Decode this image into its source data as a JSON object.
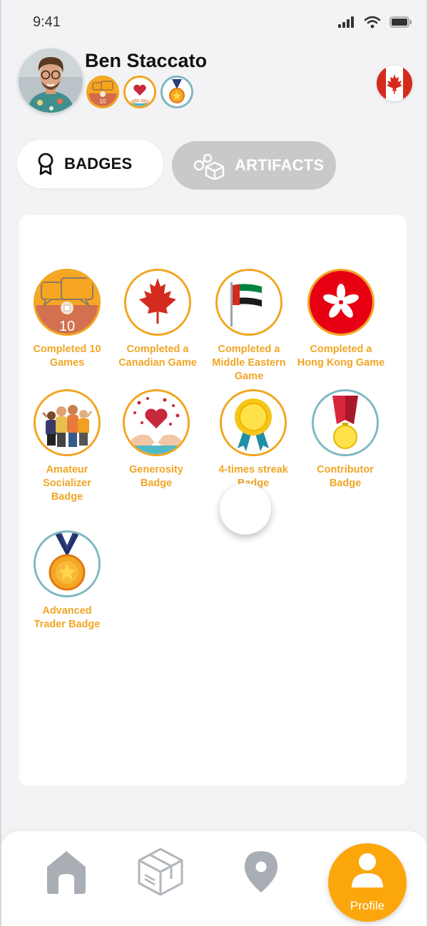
{
  "status_bar": {
    "time": "9:41"
  },
  "user": {
    "name": "Ben Staccato",
    "mini_badge_count": "10"
  },
  "tabs": {
    "badges": "BADGES",
    "artifacts": "ARTIFACTS"
  },
  "badges": [
    {
      "line1": "Completed 10",
      "line2": "Games",
      "line3": "",
      "icon": "10",
      "ring": "orange"
    },
    {
      "line1": "Completed a",
      "line2": "Canadian Game",
      "line3": "",
      "ring": "orange"
    },
    {
      "line1": "Completed a",
      "line2": "Middle Eastern",
      "line3": "Game",
      "ring": "orange"
    },
    {
      "line1": "Completed a",
      "line2": "Hong Kong Game",
      "line3": "",
      "ring": "orange"
    },
    {
      "line1": "Amateur",
      "line2": "Socializer",
      "line3": "Badge",
      "ring": "orange"
    },
    {
      "line1": "Generosity",
      "line2": "Badge",
      "line3": "",
      "ring": "orange"
    },
    {
      "line1": "4-times streak",
      "line2": "Badge",
      "line3": "",
      "ring": "orange"
    },
    {
      "line1": "Contributor",
      "line2": "Badge",
      "line3": "",
      "ring": "teal"
    },
    {
      "line1": "Advanced",
      "line2": "Trader Badge",
      "line3": "",
      "ring": "teal"
    }
  ],
  "nav": {
    "profile": "Profile"
  },
  "colors": {
    "accent": "#fba70c",
    "badge_text": "#f0a626",
    "tab_inactive": "#c9c9cc"
  },
  "icons": [
    "signal-icon",
    "wifi-icon",
    "battery-icon",
    "ribbon-badge-icon",
    "artifacts-icon",
    "home-icon",
    "box-icon",
    "location-pin-icon",
    "user-icon"
  ]
}
